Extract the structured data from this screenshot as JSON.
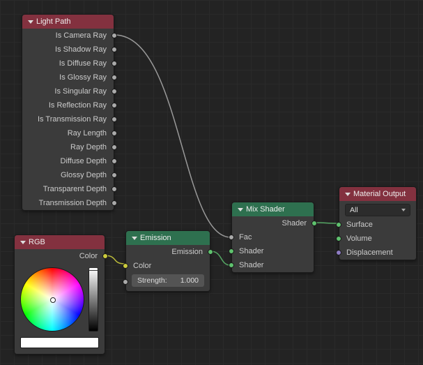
{
  "nodes": {
    "light_path": {
      "title": "Light Path",
      "outputs": [
        "Is Camera Ray",
        "Is Shadow Ray",
        "Is Diffuse Ray",
        "Is Glossy Ray",
        "Is Singular Ray",
        "Is Reflection Ray",
        "Is Transmission Ray",
        "Ray Length",
        "Ray Depth",
        "Diffuse Depth",
        "Glossy Depth",
        "Transparent Depth",
        "Transmission Depth"
      ]
    },
    "rgb": {
      "title": "RGB",
      "output_label": "Color",
      "color_hex": "#ffffff"
    },
    "emission": {
      "title": "Emission",
      "output_label": "Emission",
      "color_label": "Color",
      "strength_label": "Strength:",
      "strength_value": "1.000"
    },
    "mix_shader": {
      "title": "Mix Shader",
      "output_label": "Shader",
      "fac_label": "Fac",
      "shader1_label": "Shader",
      "shader2_label": "Shader"
    },
    "material_output": {
      "title": "Material Output",
      "mode": "All",
      "surface_label": "Surface",
      "volume_label": "Volume",
      "displacement_label": "Displacement"
    }
  },
  "chart_data": {
    "type": "node-graph",
    "nodes": [
      "Light Path",
      "RGB",
      "Emission",
      "Mix Shader",
      "Material Output"
    ],
    "edges": [
      {
        "from": "Light Path",
        "from_socket": "Is Camera Ray",
        "to": "Mix Shader",
        "to_socket": "Fac"
      },
      {
        "from": "RGB",
        "from_socket": "Color",
        "to": "Emission",
        "to_socket": "Color"
      },
      {
        "from": "Emission",
        "from_socket": "Emission",
        "to": "Mix Shader",
        "to_socket": "Shader (2)"
      },
      {
        "from": "Mix Shader",
        "from_socket": "Shader",
        "to": "Material Output",
        "to_socket": "Surface"
      }
    ]
  }
}
